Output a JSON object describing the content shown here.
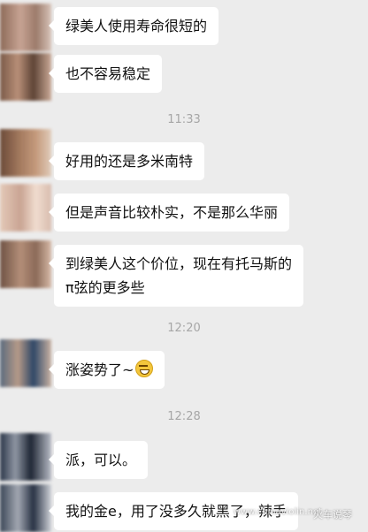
{
  "messages": [
    {
      "text": "绿美人使用寿命很短的"
    },
    {
      "text": "也不容易稳定"
    },
    {
      "text": "好用的还是多米南特"
    },
    {
      "text": "但是声音比较朴实，不是那么华丽"
    },
    {
      "line1": "到绿美人这个价位，现在有托马斯的",
      "line2": "π弦的更多些"
    },
    {
      "text": "涨姿势了~"
    },
    {
      "text": "派，可以。"
    },
    {
      "text": "我的金e，用了没多久就黑了，辣手"
    }
  ],
  "timestamps": [
    "11:33",
    "12:20",
    "12:28"
  ],
  "watermark": {
    "url": "www.chinaviolin.net",
    "logo": "火车说琴"
  }
}
